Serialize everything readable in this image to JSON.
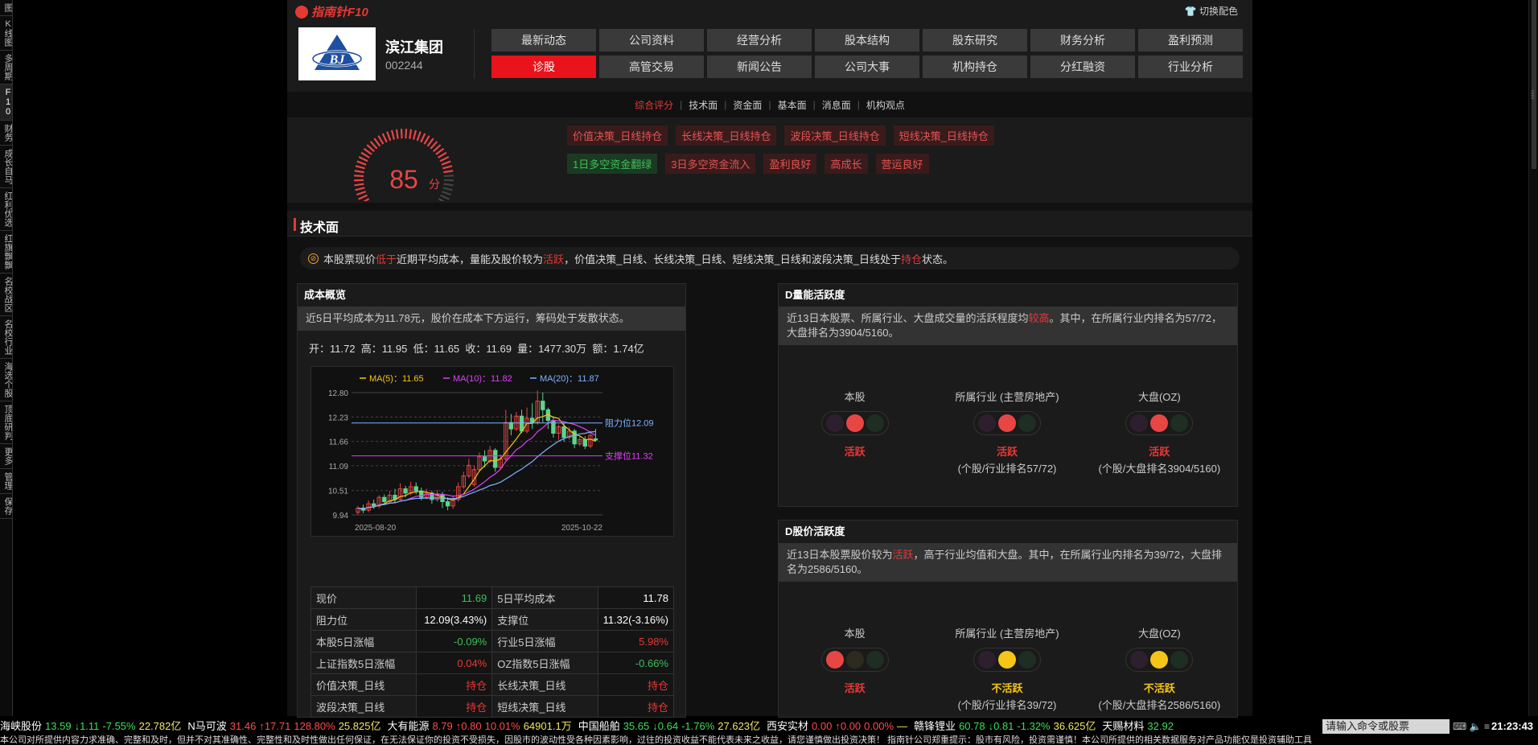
{
  "left_sidebar": [
    "图",
    "K线图",
    "多周期",
    "F10",
    "财务",
    "成长自马",
    "红利优选",
    "红旗飘飘",
    "名校战区",
    "名校行业",
    "海选个股",
    "顶底研判",
    "更多",
    "管理",
    "保存"
  ],
  "header": {
    "logo": "指南针F10",
    "theme_label": "切换配色"
  },
  "company": {
    "name": "滨江集团",
    "code": "002244",
    "logo_text": "BJ"
  },
  "nav_buttons": [
    [
      "最新动态",
      "公司资料",
      "经营分析",
      "股本结构",
      "股东研究",
      "财务分析",
      "盈利预测"
    ],
    [
      "诊股",
      "高管交易",
      "新闻公告",
      "公司大事",
      "机构持仓",
      "分红融资",
      "行业分析"
    ]
  ],
  "nav_active": "诊股",
  "sub_tabs": [
    "综合评分",
    "技术面",
    "资金面",
    "基本面",
    "消息面",
    "机构观点"
  ],
  "score": {
    "value": "85",
    "unit": "分"
  },
  "tags_row1": [
    "价值决策_日线持仓",
    "长线决策_日线持仓",
    "波段决策_日线持仓",
    "短线决策_日线持仓"
  ],
  "tags_row2": [
    {
      "text": "1日多空资金翻绿",
      "color": "green"
    },
    {
      "text": "3日多空资金流入",
      "color": "red"
    },
    {
      "text": "盈利良好",
      "color": "red"
    },
    {
      "text": "高成长",
      "color": "red"
    },
    {
      "text": "营运良好",
      "color": "red"
    }
  ],
  "section_title": "技术面",
  "notice": {
    "p1": "本股票现价",
    "h1": "低于",
    "p2": "近期平均成本，量能及股价较为",
    "h2": "活跃",
    "p3": "，价值决策_日线、长线决策_日线、短线决策_日线和波段决策_日线处于",
    "h3": "持仓",
    "p4": "状态。"
  },
  "cost": {
    "title": "成本概览",
    "desc": "近5日平均成本为11.78元，股价在成本下方运行，筹码处于发散状态。",
    "ohlc": "开：11.72  高：11.95  低：11.65  收：11.69  量：1477.30万  额：1.74亿"
  },
  "chart_data": {
    "type": "candlestick",
    "legend": [
      {
        "name": "MA(5)",
        "value": "11.65",
        "color": "#f5c518"
      },
      {
        "name": "MA(10)",
        "value": "11.82",
        "color": "#e040fb"
      },
      {
        "name": "MA(20)",
        "value": "11.87",
        "color": "#7fb3ff"
      }
    ],
    "y_ticks": [
      "12.80",
      "12.23",
      "11.66",
      "11.09",
      "10.51",
      "9.94"
    ],
    "ylim": [
      9.94,
      12.8
    ],
    "x_labels": [
      "2025-08-20",
      "2025-10-22"
    ],
    "resistance": {
      "label": "阻力位12.09",
      "value": 12.09
    },
    "support": {
      "label": "支撑位11.32",
      "value": 11.32
    },
    "candles": [
      [
        10.0,
        10.1,
        9.95,
        10.15
      ],
      [
        10.1,
        10.05,
        9.98,
        10.18
      ],
      [
        10.05,
        10.2,
        10.0,
        10.28
      ],
      [
        10.2,
        10.15,
        10.08,
        10.3
      ],
      [
        10.15,
        10.35,
        10.1,
        10.4
      ],
      [
        10.35,
        10.25,
        10.18,
        10.42
      ],
      [
        10.25,
        10.4,
        10.2,
        10.5
      ],
      [
        10.4,
        10.3,
        10.22,
        10.55
      ],
      [
        10.3,
        10.55,
        10.28,
        10.68
      ],
      [
        10.55,
        10.45,
        10.35,
        10.62
      ],
      [
        10.45,
        10.6,
        10.4,
        10.72
      ],
      [
        10.6,
        10.5,
        10.42,
        10.7
      ],
      [
        10.5,
        10.35,
        10.28,
        10.58
      ],
      [
        10.35,
        10.45,
        10.3,
        10.55
      ],
      [
        10.45,
        10.3,
        10.2,
        10.5
      ],
      [
        10.3,
        10.42,
        10.25,
        10.52
      ],
      [
        10.42,
        10.25,
        10.1,
        10.48
      ],
      [
        10.25,
        10.15,
        10.05,
        10.35
      ],
      [
        10.15,
        10.3,
        10.08,
        10.4
      ],
      [
        10.3,
        10.6,
        10.25,
        10.7
      ],
      [
        10.6,
        10.85,
        10.55,
        10.95
      ],
      [
        10.85,
        11.1,
        10.8,
        11.25
      ],
      [
        10.65,
        11.0,
        10.6,
        11.1
      ],
      [
        11.0,
        11.3,
        10.95,
        11.4
      ],
      [
        11.3,
        11.2,
        11.05,
        11.45
      ],
      [
        11.2,
        11.45,
        11.15,
        11.55
      ],
      [
        11.45,
        11.05,
        10.95,
        11.5
      ],
      [
        11.05,
        11.25,
        11.0,
        11.35
      ],
      [
        11.25,
        12.1,
        11.2,
        12.4
      ],
      [
        12.1,
        11.95,
        11.8,
        12.3
      ],
      [
        11.95,
        12.25,
        11.9,
        12.35
      ],
      [
        12.25,
        11.9,
        11.85,
        12.4
      ],
      [
        11.9,
        12.2,
        11.85,
        12.45
      ],
      [
        12.2,
        12.1,
        11.95,
        12.55
      ],
      [
        12.1,
        12.6,
        12.05,
        12.85
      ],
      [
        12.6,
        12.4,
        12.1,
        12.8
      ],
      [
        12.4,
        12.15,
        11.95,
        12.45
      ],
      [
        12.15,
        11.85,
        11.75,
        12.25
      ],
      [
        11.85,
        12.0,
        11.7,
        12.05
      ],
      [
        12.0,
        11.75,
        11.65,
        12.1
      ],
      [
        11.75,
        11.9,
        11.7,
        12.0
      ],
      [
        11.9,
        11.6,
        11.5,
        11.95
      ],
      [
        11.6,
        11.7,
        11.55,
        11.8
      ],
      [
        11.7,
        11.55,
        11.48,
        11.78
      ],
      [
        11.55,
        11.8,
        11.5,
        11.9
      ],
      [
        11.72,
        11.69,
        11.65,
        11.95
      ]
    ]
  },
  "stats": [
    [
      {
        "k": "现价",
        "v": "11.69",
        "c": "green"
      },
      {
        "k": "5日平均成本",
        "v": "11.78",
        "c": "white"
      }
    ],
    [
      {
        "k": "阻力位",
        "v": "12.09(3.43%)",
        "c": "white"
      },
      {
        "k": "支撑位",
        "v": "11.32(-3.16%)",
        "c": "white"
      }
    ],
    [
      {
        "k": "本股5日涨幅",
        "v": "-0.09%",
        "c": "green"
      },
      {
        "k": "行业5日涨幅",
        "v": "5.98%",
        "c": "red"
      }
    ],
    [
      {
        "k": "上证指数5日涨幅",
        "v": "0.04%",
        "c": "red"
      },
      {
        "k": "OZ指数5日涨幅",
        "v": "-0.66%",
        "c": "green"
      }
    ],
    [
      {
        "k": "价值决策_日线",
        "v": "持仓",
        "c": "red"
      },
      {
        "k": "长线决策_日线",
        "v": "持仓",
        "c": "red"
      }
    ],
    [
      {
        "k": "波段决策_日线",
        "v": "持仓",
        "c": "red"
      },
      {
        "k": "短线决策_日线",
        "v": "持仓",
        "c": "red"
      }
    ]
  ],
  "volume_activity": {
    "title": "D量能活跃度",
    "d1": "近13日本股票、所属行业、大盘成交量的活跃程度均",
    "hl": "较高",
    "d2": "。其中，在所属行业内排名为57/72，大盘排名为3904/5160。",
    "cols": [
      {
        "label": "本股",
        "lit": 1,
        "status": "活跃",
        "color": "red",
        "rank": ""
      },
      {
        "label": "所属行业 (主营房地产)",
        "lit": 1,
        "status": "活跃",
        "color": "red",
        "rank": "(个股/行业排名57/72)"
      },
      {
        "label": "大盘(OZ)",
        "lit": 1,
        "status": "活跃",
        "color": "red",
        "rank": "(个股/大盘排名3904/5160)"
      }
    ]
  },
  "price_activity": {
    "title": "D股价活跃度",
    "d1": "近13日本股票股价较为",
    "hl": "活跃",
    "d2": "，高于行业均值和大盘。其中，在所属行业内排名为39/72，大盘排名为2586/5160。",
    "cols": [
      {
        "label": "本股",
        "lit": 0,
        "status": "活跃",
        "color": "red",
        "rank": ""
      },
      {
        "label": "所属行业 (主营房地产)",
        "lit": 1,
        "status": "不活跃",
        "color": "yellow",
        "rank": "(个股/行业排名39/72)"
      },
      {
        "label": "大盘(OZ)",
        "lit": 1,
        "status": "不活跃",
        "color": "yellow",
        "rank": "(个股/大盘排名2586/5160)"
      }
    ]
  },
  "ticker": [
    {
      "name": "海峡股份",
      "price": "13.59",
      "arrow": "↓",
      "chg": "1.11",
      "pct": "-7.55%",
      "vol": "22.782亿",
      "dir": "dn"
    },
    {
      "name": "N马可波",
      "price": "31.46",
      "arrow": "↑",
      "chg": "17.71",
      "pct": "128.80%",
      "vol": "25.825亿",
      "dir": "up"
    },
    {
      "name": "大有能源",
      "price": "8.79",
      "arrow": "↑",
      "chg": "0.80",
      "pct": "10.01%",
      "vol": "64901.1万",
      "dir": "up"
    },
    {
      "name": "中国船舶",
      "price": "35.65",
      "arrow": "↓",
      "chg": "0.64",
      "pct": "-1.76%",
      "vol": "27.623亿",
      "dir": "dn"
    },
    {
      "name": "西安实材",
      "price": "0.00",
      "arrow": "↑",
      "chg": "0.00",
      "pct": "0.00%",
      "vol": "—",
      "dir": "up"
    },
    {
      "name": "赣锋锂业",
      "price": "60.78",
      "arrow": "↓",
      "chg": "0.81",
      "pct": "-1.32%",
      "vol": "36.625亿",
      "dir": "dn"
    },
    {
      "name": "天赐材料",
      "price": "32.92",
      "arrow": "",
      "chg": "",
      "pct": "",
      "vol": "",
      "dir": "dn"
    }
  ],
  "command_placeholder": "请输入命令或股票",
  "clock": "21:23:43",
  "disclaimer": "本公司对所提供内容力求准确、完整和及时，但并不对其准确性、完整性和及时性做出任何保证，在无法保证你的投资不受损失，因股市的波动性受各种因素影响，过往的投资收益不能代表未来之收益，请您谨慎做出投资决策！     指南针公司郑重提示：股市有风险，投资需谨慎！本公司所提供的相关数据服务对产品功能仅是投资辅助工具"
}
